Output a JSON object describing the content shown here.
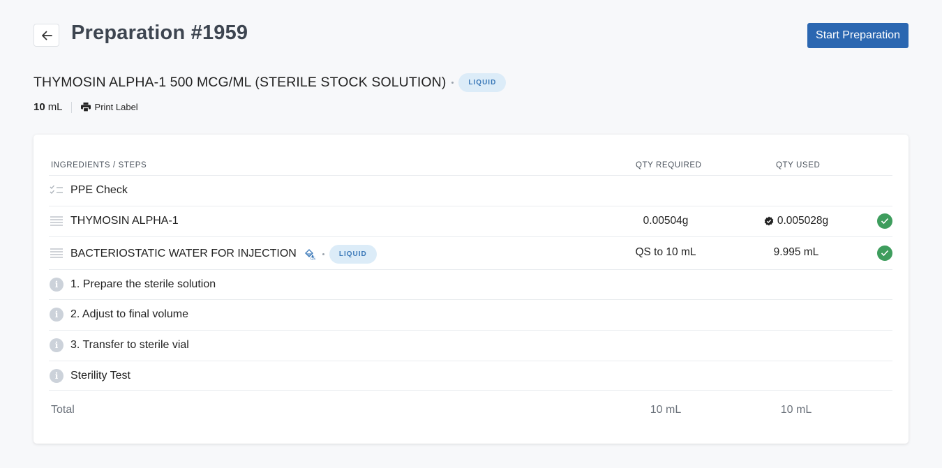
{
  "header": {
    "title": "Preparation #1959",
    "start_button": "Start Preparation"
  },
  "product": {
    "name": "THYMOSIN ALPHA-1 500 MCG/ML (STERILE STOCK SOLUTION)",
    "form_badge": "LIQUID",
    "volume_value": "10",
    "volume_unit": "mL",
    "print_label": "Print Label"
  },
  "table": {
    "columns": {
      "ingredients": "INGREDIENTS / STEPS",
      "qty_required": "QTY REQUIRED",
      "qty_used": "QTY USED"
    },
    "rows": [
      {
        "type": "checklist",
        "icon": "checklist-icon",
        "name": "PPE Check",
        "qty_required": "",
        "qty_used": ""
      },
      {
        "type": "ingredient",
        "icon": "drag-handle-icon",
        "name": "THYMOSIN ALPHA-1",
        "qty_required": "0.00504g",
        "qty_used": "0.005028g",
        "verified": true,
        "completed": true
      },
      {
        "type": "ingredient",
        "icon": "drag-handle-icon",
        "name": "BACTERIOSTATIC WATER FOR INJECTION",
        "extra_icon": "qs-fill-icon",
        "badge": "LIQUID",
        "qty_required": "QS to 10 mL",
        "qty_used": "9.995 mL",
        "completed": true
      },
      {
        "type": "step",
        "icon": "info-icon",
        "name": "1. Prepare the sterile solution"
      },
      {
        "type": "step",
        "icon": "info-icon",
        "name": "2. Adjust to final volume"
      },
      {
        "type": "step",
        "icon": "info-icon",
        "name": "3. Transfer to sterile vial"
      },
      {
        "type": "step",
        "icon": "info-icon",
        "name": "Sterility Test"
      }
    ],
    "total": {
      "label": "Total",
      "qty_required": "10 mL",
      "qty_used": "10 mL"
    }
  },
  "colors": {
    "primary": "#2b67b1",
    "success": "#3e9d5d",
    "badge_bg": "#dcecf8",
    "badge_text": "#3a78b8"
  }
}
